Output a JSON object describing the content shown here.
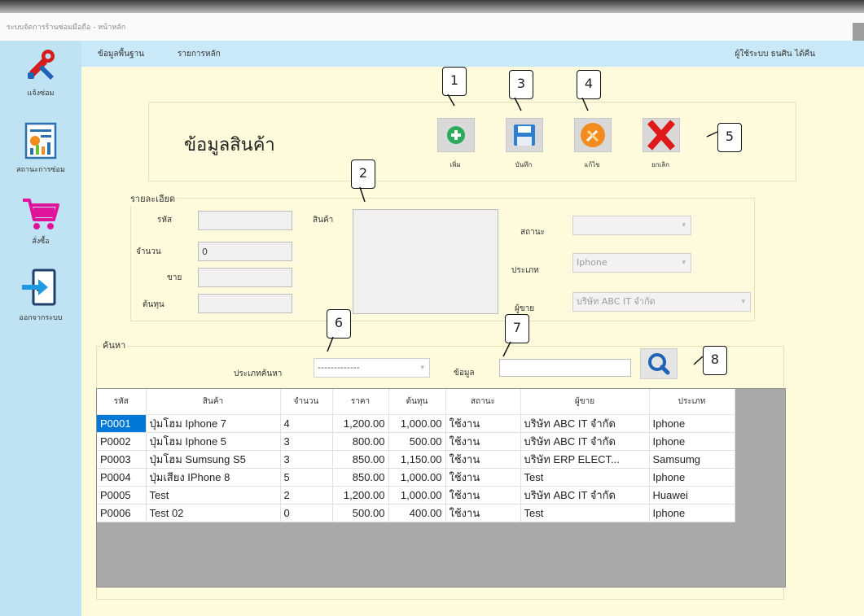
{
  "window": {
    "title": "ระบบจัดการร้านซ่อมมือถือ - หน้าหลัก"
  },
  "sidebar": {
    "items": [
      {
        "label": "แจ้งซ่อม",
        "icon": "repair-tools-icon"
      },
      {
        "label": "สถานะการซ่อม",
        "icon": "report-chart-icon"
      },
      {
        "label": "สั่งซื้อ",
        "icon": "shopping-cart-icon"
      },
      {
        "label": "ออกจากระบบ",
        "icon": "logout-door-icon"
      }
    ]
  },
  "menubar": {
    "items": [
      "ข้อมูลพื้นฐาน",
      "รายการหลัก"
    ],
    "user": "ผู้ใช้ระบบ  ธนศิน ได้คืน"
  },
  "header": {
    "title": "ข้อมูลสินค้า"
  },
  "toolbar": {
    "add": "เพิ่ม",
    "save": "บันทึก",
    "edit": "แก้ไข",
    "cancel": "ยกเลิก"
  },
  "callouts": [
    "1",
    "2",
    "3",
    "4",
    "5",
    "6",
    "7",
    "8"
  ],
  "details": {
    "group_title": "รายละเอียด",
    "code_label": "รหัส",
    "code_value": "",
    "qty_label": "จำนวน",
    "qty_value": "0",
    "sell_label": "ขาย",
    "sell_value": "",
    "cost_label": "ต้นทุน",
    "cost_value": "",
    "product_label": "สินค้า",
    "product_value": "",
    "status_label": "สถานะ",
    "status_value": "",
    "type_label": "ประเภท",
    "type_value": "Iphone",
    "seller_label": "ผู้ขาย",
    "seller_value": "บริษัท ABC IT จำกัด"
  },
  "search": {
    "group_title": "ค้นหา",
    "type_label": "ประเภทค้นหา",
    "type_value": "-------------",
    "data_label": "ข้อมูล",
    "data_value": ""
  },
  "table": {
    "columns": [
      "รหัส",
      "สินค้า",
      "จำนวน",
      "ราคา",
      "ต้นทุน",
      "สถานะ",
      "ผู้ขาย",
      "ประเภท"
    ],
    "rows": [
      [
        "P0001",
        "ปุ่มโฮม Iphone 7",
        "4",
        "1,200.00",
        "1,000.00",
        "ใช้งาน",
        "บริษัท ABC IT จำกัด",
        "Iphone"
      ],
      [
        "P0002",
        "ปุ่มโฮม Iphone 5",
        "3",
        "800.00",
        "500.00",
        "ใช้งาน",
        "บริษัท ABC IT จำกัด",
        "Iphone"
      ],
      [
        "P0003",
        "ปุ่มโฮม Sumsung S5",
        "3",
        "850.00",
        "1,150.00",
        "ใช้งาน",
        "บริษัท ERP ELECT...",
        "Samsumg"
      ],
      [
        "P0004",
        "ปุ่มเสียง IPhone 8",
        "5",
        "850.00",
        "1,000.00",
        "ใช้งาน",
        "Test",
        "Iphone"
      ],
      [
        "P0005",
        "Test",
        "2",
        "1,200.00",
        "1,000.00",
        "ใช้งาน",
        "บริษัท ABC IT จำกัด",
        "Huawei"
      ],
      [
        "P0006",
        "Test 02",
        "0",
        "500.00",
        "400.00",
        "ใช้งาน",
        "Test",
        "Iphone"
      ]
    ]
  },
  "colors": {
    "sidebar_bg": "#bfe3f3",
    "main_bg": "#fdfbdc",
    "selection": "#0078d7",
    "add_green": "#2eaa5c",
    "save_blue": "#2f7fd1",
    "edit_orange": "#f28c1e",
    "cancel_red": "#e0191b"
  }
}
